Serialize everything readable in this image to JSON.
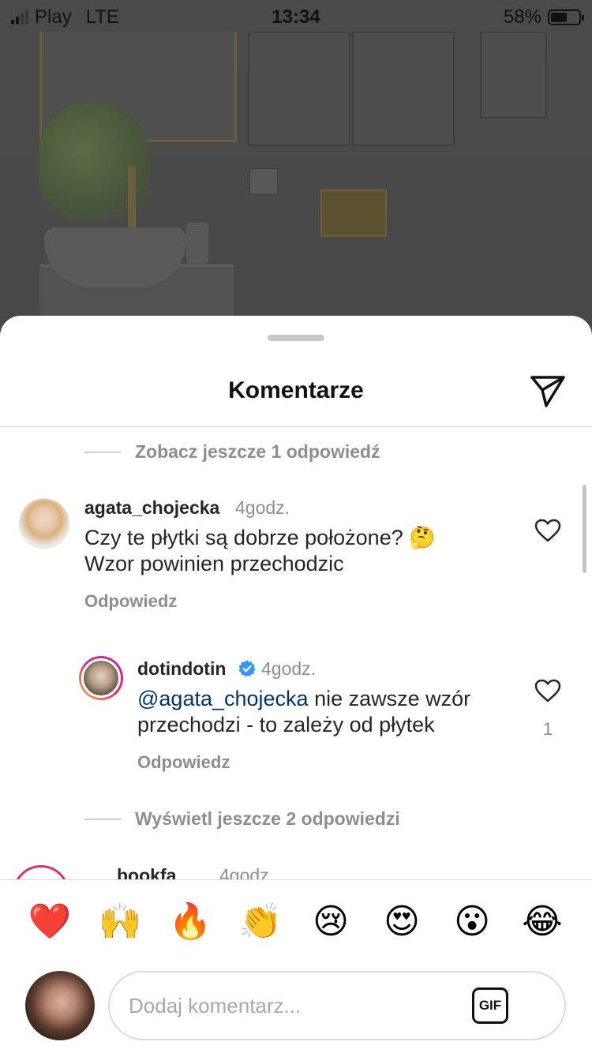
{
  "status_bar": {
    "carrier": "Play",
    "network": "LTE",
    "time": "13:34",
    "battery_percent": "58%",
    "battery_level": 0.58,
    "signal_bars_active": 2,
    "signal_bars_total": 4
  },
  "sheet": {
    "title": "Komentarze",
    "send_icon": "paper-plane-icon"
  },
  "thread": {
    "more_replies_top": "Zobacz jeszcze 1 odpowiedź",
    "comments": [
      {
        "username": "agata_chojecka",
        "time": "4godz.",
        "text": "Czy te płytki są dobrze położone? 🤔 Wzor powinien przechodzic",
        "reply_label": "Odpowiedz"
      },
      {
        "username": "dotindotin",
        "verified": true,
        "time": "4godz.",
        "mention": "@agata_chojecka",
        "text": " nie zawsze wzór przechodzi - to zależy od płytek",
        "reply_label": "Odpowiedz",
        "like_count": "1"
      },
      {
        "username": "bookfa",
        "time": "4godz."
      }
    ],
    "more_replies_bottom": "Wyświetl jeszcze 2 odpowiedzi"
  },
  "reactions": [
    "❤️",
    "🙌",
    "🔥",
    "👏",
    "😢",
    "😍",
    "😮",
    "😂"
  ],
  "composer": {
    "placeholder": "Dodaj komentarz...",
    "gif_label": "GIF"
  },
  "colors": {
    "accent_link": "#00376b",
    "verified_badge": "#3897f0",
    "secondary_text": "#8e8e8e"
  }
}
